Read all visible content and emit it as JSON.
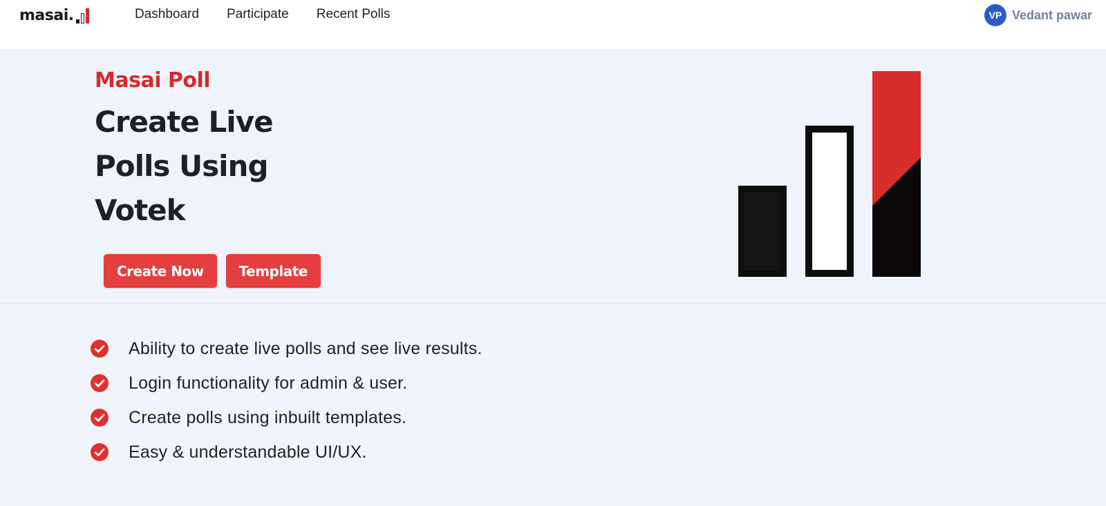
{
  "header": {
    "logo_text": "masai.",
    "nav": [
      {
        "label": "Dashboard"
      },
      {
        "label": "Participate"
      },
      {
        "label": "Recent Polls"
      }
    ],
    "user": {
      "initials": "VP",
      "name": "Vedant pawar"
    }
  },
  "hero": {
    "brand": "Masai Poll",
    "headline": "Create Live Polls Using Votek",
    "buttons": {
      "create": "Create Now",
      "template": "Template"
    }
  },
  "features": [
    {
      "text": "Ability to create live polls and see live results.",
      "icon": "check-circle-icon"
    },
    {
      "text": "Login functionality for admin & user.",
      "icon": "check-circle-icon"
    },
    {
      "text": "Create polls using inbuilt templates.",
      "icon": "check-circle-icon"
    },
    {
      "text": "Easy & understandable UI/UX.",
      "icon": "check-circle-icon"
    }
  ],
  "colors": {
    "accent": "#e53e3e",
    "brand_red": "#d42b2b",
    "avatar_blue": "#2b5dc7",
    "hero_bg": "#eff4fc"
  }
}
